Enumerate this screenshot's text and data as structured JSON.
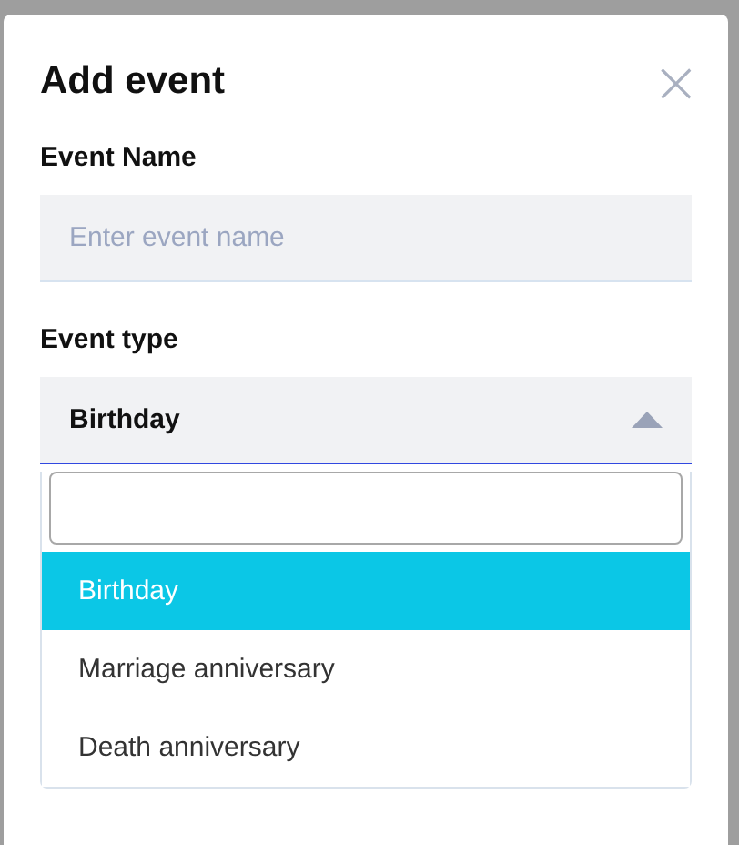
{
  "dialog": {
    "title": "Add event",
    "close": "×"
  },
  "fields": [
    {
      "label": "Event Name",
      "placeholder": "Enter event name"
    }
  ],
  "event_type": {
    "label": "Event type",
    "value": "Birthday",
    "expanded": true,
    "options": [
      {
        "label": "Birthday",
        "selected": true
      },
      {
        "label": "Marriage anniversary",
        "selected": false
      },
      {
        "label": "Death anniversary",
        "selected": false
      }
    ]
  }
}
